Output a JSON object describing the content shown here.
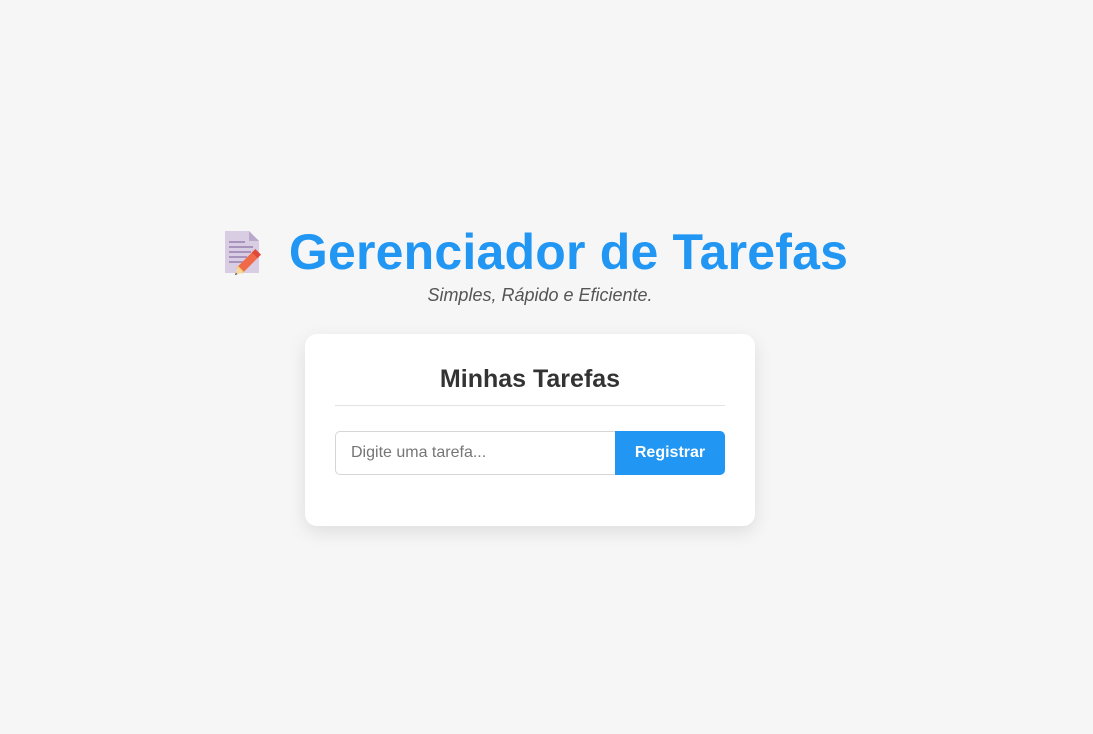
{
  "header": {
    "icon": "memo-icon",
    "title": "Gerenciador de Tarefas",
    "subtitle": "Simples, Rápido e Eficiente."
  },
  "card": {
    "title": "Minhas Tarefas",
    "task_input": {
      "value": "",
      "placeholder": "Digite uma tarefa..."
    },
    "register_label": "Registrar"
  },
  "colors": {
    "accent": "#2196f3",
    "background": "#f6f6f6",
    "card_background": "#ffffff",
    "heading_text": "#333333",
    "subtitle_text": "#555555"
  }
}
